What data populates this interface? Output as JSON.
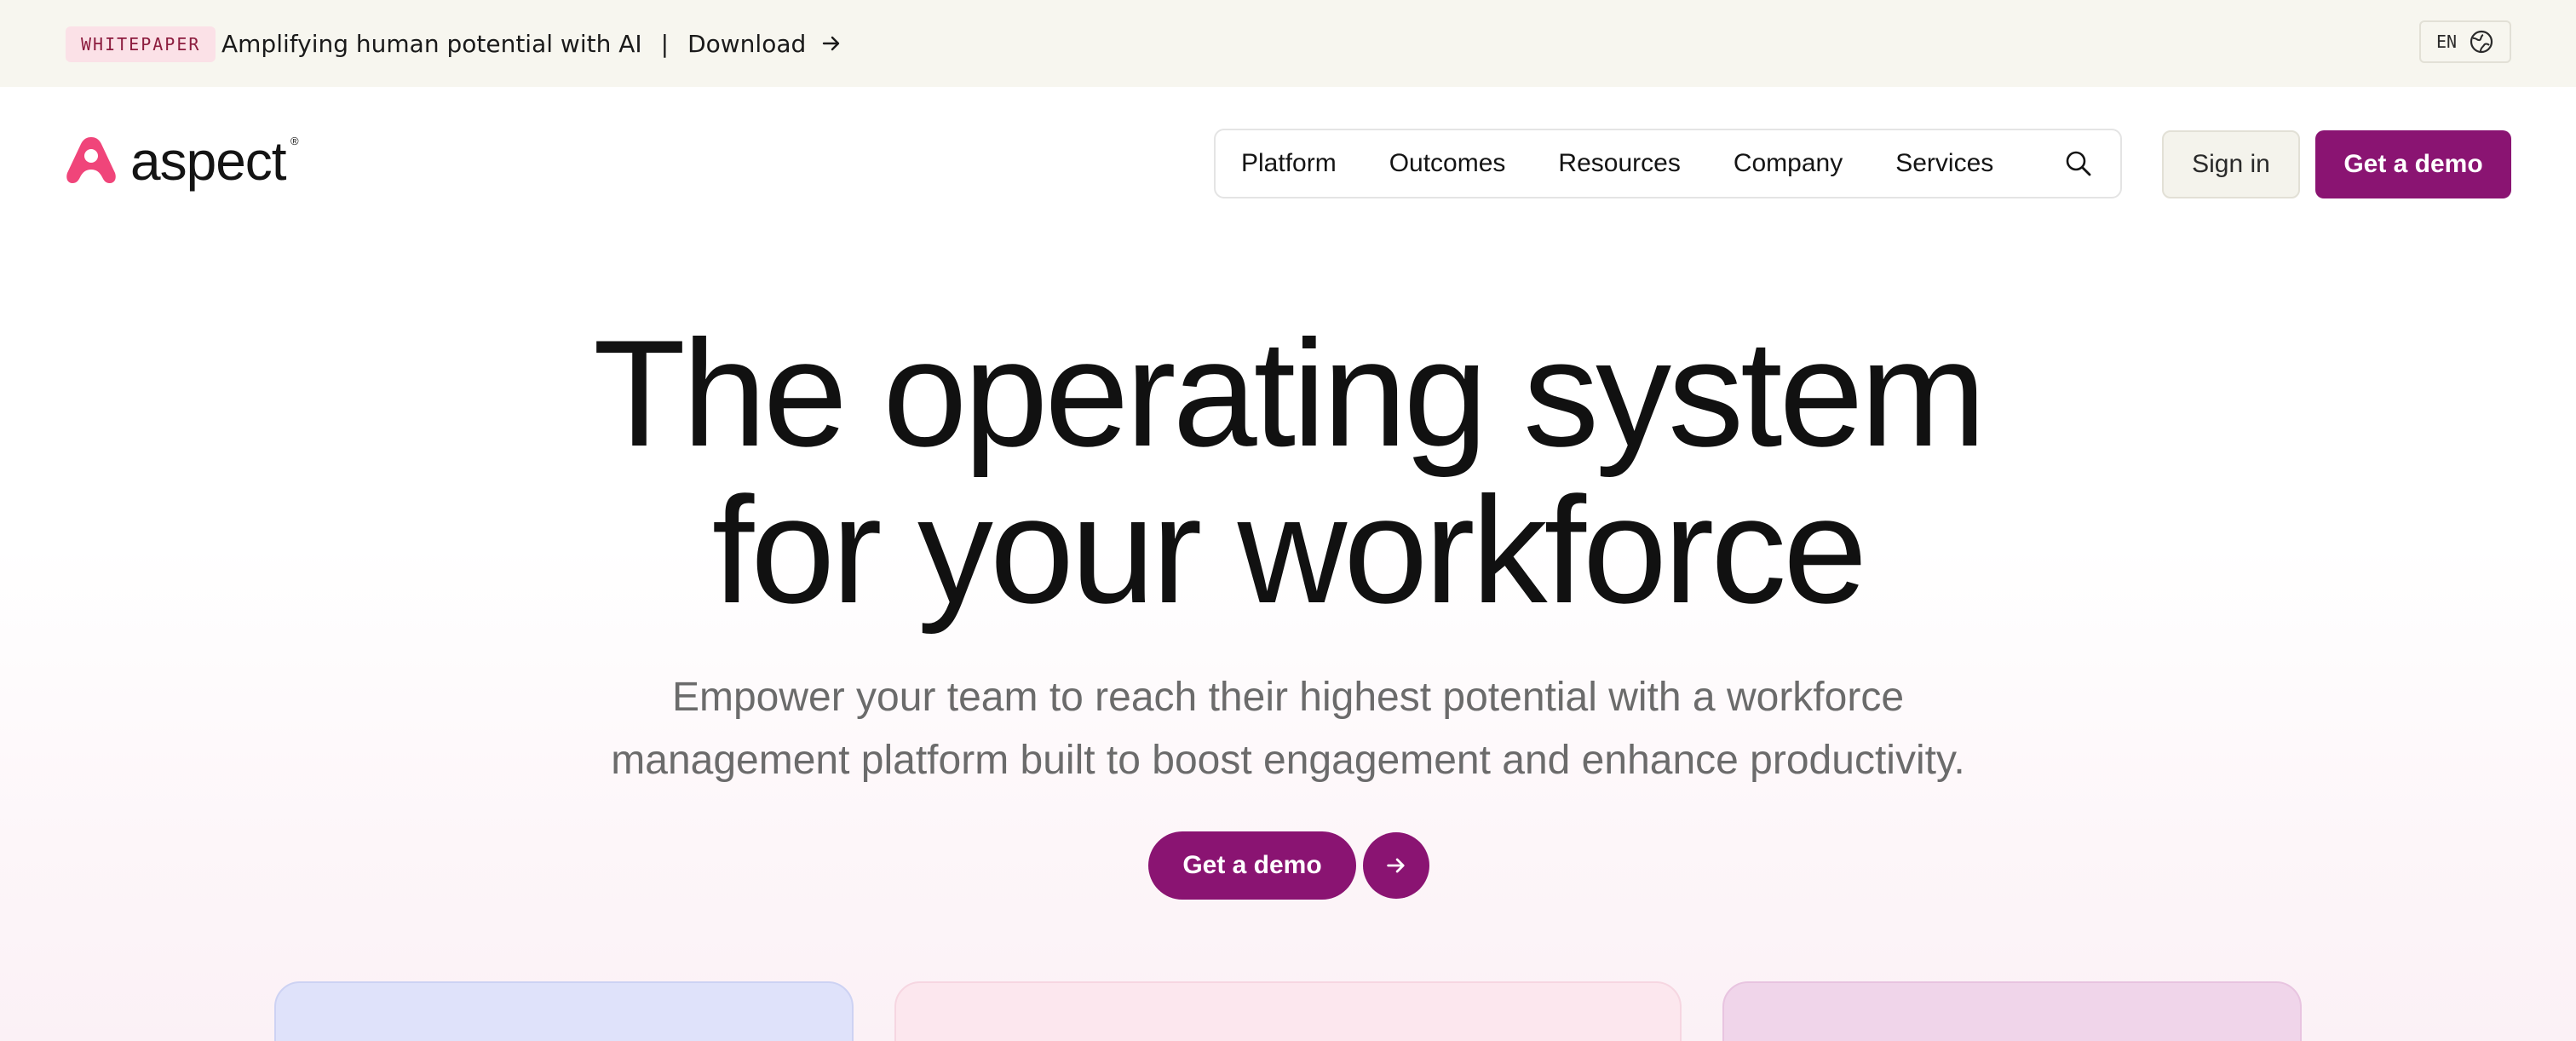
{
  "announcement": {
    "tag": "WHITEPAPER",
    "message": "Amplifying human potential with AI",
    "separator": "|",
    "link": "Download",
    "lang": "EN"
  },
  "header": {
    "logo_text": "aspect",
    "logo_mark": "®",
    "nav": [
      "Platform",
      "Outcomes",
      "Resources",
      "Company",
      "Services"
    ],
    "sign_in": "Sign in",
    "get_demo": "Get a demo"
  },
  "hero": {
    "title_line1": "The operating system",
    "title_line2": "for your workforce",
    "subtitle_line1": "Empower your team to reach their highest potential with a workforce",
    "subtitle_line2": "management platform built to boost engagement and enhance productivity.",
    "cta": "Get a demo"
  },
  "colors": {
    "brand": "#8a1472",
    "logo_pink": "#f0457a",
    "announce_bg": "#f7f6ef",
    "card_blue": "#dfe2fa",
    "card_pink": "#fce7ee",
    "card_purple": "#f0d5ea"
  },
  "icons": {
    "download_arrow": "arrow-right-icon",
    "lang": "globe-icon",
    "search": "search-icon",
    "cta_arrow": "arrow-right-icon",
    "logo": "aspect-logo-icon"
  }
}
